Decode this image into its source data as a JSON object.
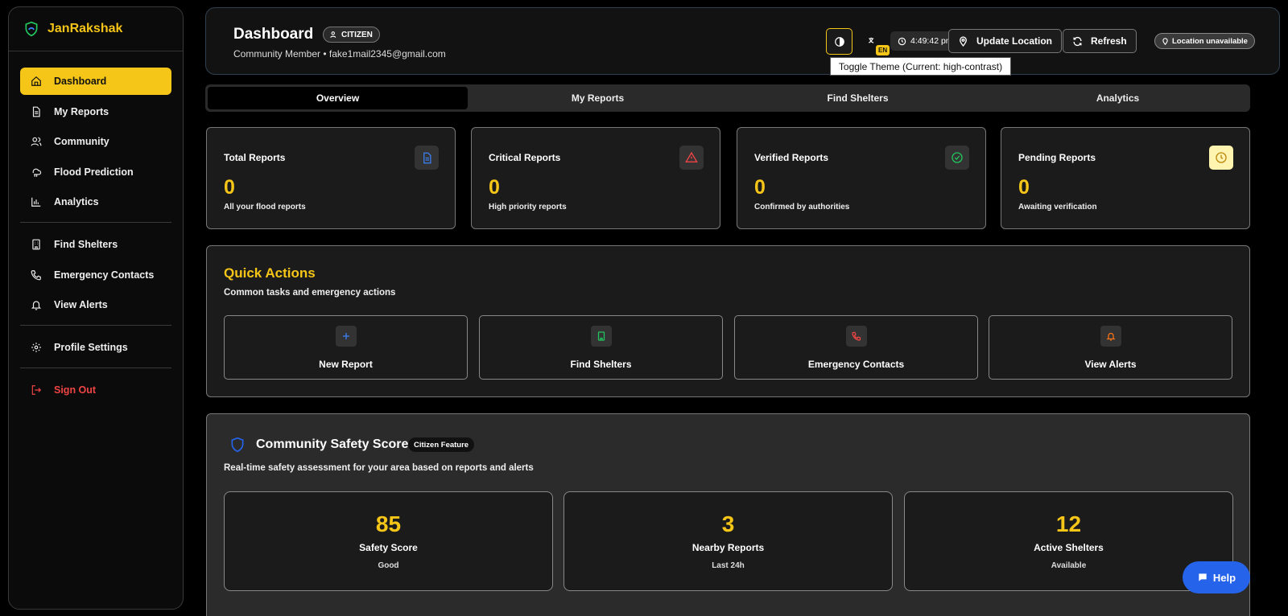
{
  "brand": {
    "name": "JanRakshak"
  },
  "sidebar": {
    "items": [
      {
        "label": "Dashboard",
        "icon": "home-icon"
      },
      {
        "label": "My Reports",
        "icon": "file-icon"
      },
      {
        "label": "Community",
        "icon": "users-icon"
      },
      {
        "label": "Flood Prediction",
        "icon": "cloud-rain-icon"
      },
      {
        "label": "Analytics",
        "icon": "bar-chart-icon"
      },
      {
        "label": "Find Shelters",
        "icon": "building-icon"
      },
      {
        "label": "Emergency Contacts",
        "icon": "phone-icon"
      },
      {
        "label": "View Alerts",
        "icon": "bell-icon"
      },
      {
        "label": "Profile Settings",
        "icon": "gear-icon"
      },
      {
        "label": "Sign Out",
        "icon": "logout-icon"
      }
    ]
  },
  "header": {
    "title": "Dashboard",
    "role": "CITIZEN",
    "subtitle": "Community Member • fake1mail2345@gmail.com",
    "lang": "EN",
    "time": "4:49:42 pm",
    "update_location": "Update Location",
    "refresh": "Refresh",
    "location_status": "Location unavailable",
    "tooltip": "Toggle Theme (Current: high-contrast)"
  },
  "tabs": [
    "Overview",
    "My Reports",
    "Find Shelters",
    "Analytics"
  ],
  "stats": [
    {
      "label": "Total Reports",
      "value": "0",
      "desc": "All your flood reports",
      "color": "#3b82f6"
    },
    {
      "label": "Critical Reports",
      "value": "0",
      "desc": "High priority reports",
      "color": "#ef4444"
    },
    {
      "label": "Verified Reports",
      "value": "0",
      "desc": "Confirmed by authorities",
      "color": "#22c55e"
    },
    {
      "label": "Pending Reports",
      "value": "0",
      "desc": "Awaiting verification",
      "color": "#f5c518"
    }
  ],
  "quick_actions": {
    "title": "Quick Actions",
    "subtitle": "Common tasks and emergency actions",
    "items": [
      {
        "label": "New Report",
        "icon": "plus-icon"
      },
      {
        "label": "Find Shelters",
        "icon": "building-icon"
      },
      {
        "label": "Emergency Contacts",
        "icon": "phone-icon"
      },
      {
        "label": "View Alerts",
        "icon": "bell-icon"
      }
    ]
  },
  "safety": {
    "title": "Community Safety Score",
    "badge": "Citizen Feature",
    "subtitle": "Real-time safety assessment for your area based on reports and alerts",
    "cards": [
      {
        "value": "85",
        "label": "Safety Score",
        "desc": "Good"
      },
      {
        "value": "3",
        "label": "Nearby Reports",
        "desc": "Last 24h"
      },
      {
        "value": "12",
        "label": "Active Shelters",
        "desc": "Available"
      }
    ]
  },
  "help": "Help",
  "colors": {
    "accent": "#f5c518",
    "primary": "#2563eb",
    "danger": "#ef4444"
  }
}
